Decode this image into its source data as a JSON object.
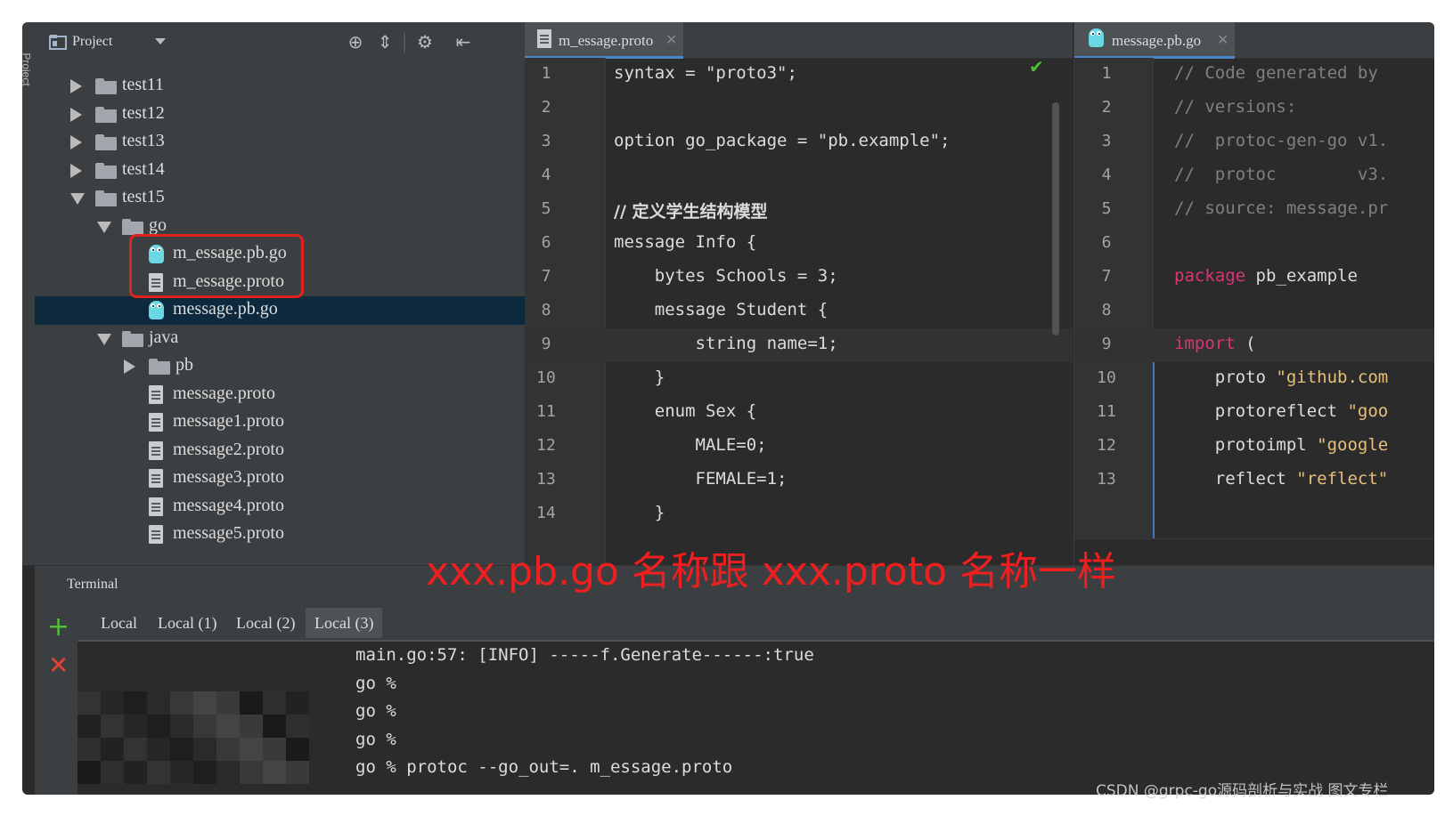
{
  "side_stripe": {
    "label": "Project"
  },
  "project_panel": {
    "title": "Project",
    "tree": [
      {
        "label": "test11",
        "type": "folder",
        "expanded": false,
        "depth": 0
      },
      {
        "label": "test12",
        "type": "folder",
        "expanded": false,
        "depth": 0
      },
      {
        "label": "test13",
        "type": "folder",
        "expanded": false,
        "depth": 0
      },
      {
        "label": "test14",
        "type": "folder",
        "expanded": false,
        "depth": 0
      },
      {
        "label": "test15",
        "type": "folder",
        "expanded": true,
        "depth": 0
      },
      {
        "label": "go",
        "type": "folder",
        "expanded": true,
        "depth": 1
      },
      {
        "label": "m_essage.pb.go",
        "type": "gofile",
        "depth": 2
      },
      {
        "label": "m_essage.proto",
        "type": "file",
        "depth": 2
      },
      {
        "label": "message.pb.go",
        "type": "gofile",
        "depth": 2,
        "selected": true
      },
      {
        "label": "java",
        "type": "folder",
        "expanded": true,
        "depth": 1
      },
      {
        "label": "pb",
        "type": "folder",
        "expanded": false,
        "depth": 2
      },
      {
        "label": "message.proto",
        "type": "file",
        "depth": 2
      },
      {
        "label": "message1.proto",
        "type": "file",
        "depth": 2
      },
      {
        "label": "message2.proto",
        "type": "file",
        "depth": 2
      },
      {
        "label": "message3.proto",
        "type": "file",
        "depth": 2
      },
      {
        "label": "message4.proto",
        "type": "file",
        "depth": 2
      },
      {
        "label": "message5.proto",
        "type": "file",
        "depth": 2
      }
    ]
  },
  "editor_left": {
    "tab_label": "m_essage.proto",
    "lines": [
      {
        "n": "1",
        "text": "syntax = \"proto3\";"
      },
      {
        "n": "2",
        "text": ""
      },
      {
        "n": "3",
        "text": "option go_package = \"pb.example\";"
      },
      {
        "n": "4",
        "text": ""
      },
      {
        "n": "5",
        "text": "// 定义学生结构模型"
      },
      {
        "n": "6",
        "text": "message Info {"
      },
      {
        "n": "7",
        "text": "    bytes Schools = 3;"
      },
      {
        "n": "8",
        "text": "    message Student {"
      },
      {
        "n": "9",
        "text": "        string name=1;"
      },
      {
        "n": "10",
        "text": "    }"
      },
      {
        "n": "11",
        "text": "    enum Sex {"
      },
      {
        "n": "12",
        "text": "        MALE=0;"
      },
      {
        "n": "13",
        "text": "        FEMALE=1;"
      },
      {
        "n": "14",
        "text": "    }"
      }
    ]
  },
  "editor_right": {
    "tab_label": "message.pb.go",
    "lines": [
      {
        "n": "1",
        "text": "// Code generated by"
      },
      {
        "n": "2",
        "text": "// versions:"
      },
      {
        "n": "3",
        "text": "//  protoc-gen-go v1."
      },
      {
        "n": "4",
        "text": "//  protoc        v3."
      },
      {
        "n": "5",
        "text": "// source: message.pr"
      },
      {
        "n": "6",
        "text": ""
      },
      {
        "n": "7",
        "kw": "package",
        "rest": " pb_example"
      },
      {
        "n": "8",
        "text": ""
      },
      {
        "n": "9",
        "kw": "import",
        "rest": " ("
      },
      {
        "n": "10",
        "id": "    proto ",
        "str": "\"github.com"
      },
      {
        "n": "11",
        "id": "    protoreflect ",
        "str": "\"goo"
      },
      {
        "n": "12",
        "id": "    protoimpl ",
        "str": "\"google"
      },
      {
        "n": "13",
        "id": "    reflect ",
        "str": "\"reflect\""
      }
    ]
  },
  "terminal": {
    "title": "Terminal",
    "tabs": [
      "Local",
      "Local (1)",
      "Local (2)",
      "Local (3)"
    ],
    "active_tab": "Local (3)",
    "lines": [
      "main.go:57: [INFO] -----f.Generate------:true",
      "go %",
      "go %",
      "go %",
      "go % protoc --go_out=. m_essage.proto"
    ]
  },
  "annotation": "xxx.pb.go 名称跟 xxx.proto 名称一样",
  "watermark": "CSDN @grpc-go源码剖析与实战 图文专栏",
  "colors": {
    "annotation": "#ef1f1f",
    "keyword": "#d93575",
    "string": "#e6c07b",
    "comment": "#808080",
    "selection": "#0d293e",
    "highlight_box": "#e0221d"
  }
}
